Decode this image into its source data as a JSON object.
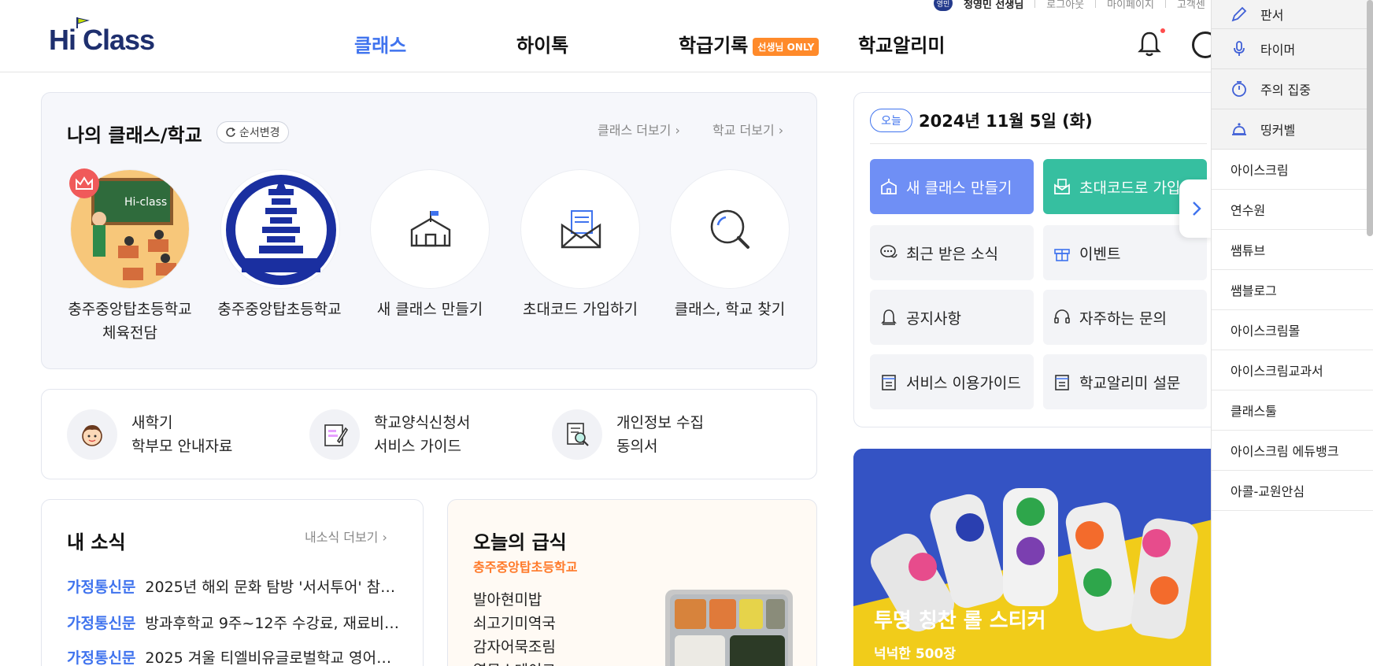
{
  "header": {
    "logo": "Hi Class",
    "nav": [
      {
        "label": "클래스"
      },
      {
        "label": "하이톡"
      },
      {
        "label": "학급기록"
      },
      {
        "label": "학교알리미"
      }
    ],
    "only_badge": "선생님 ONLY",
    "accent": "#3f73ee"
  },
  "util": {
    "badge": "영민",
    "user": "정영민 선생님",
    "logout": "로그아웃",
    "mypage": "마이페이지",
    "support": "고객센"
  },
  "my_class": {
    "title": "나의 클래스/학교",
    "reorder": "순서변경",
    "more_class": "클래스 더보기",
    "more_school": "학교 더보기",
    "items": [
      {
        "label": "충주중앙탑초등학교 체육전담"
      },
      {
        "label": "충주중앙탑초등학교"
      },
      {
        "label": "새 클래스 만들기"
      },
      {
        "label": "초대코드 가입하기"
      },
      {
        "label": "클래스, 학교 찾기"
      }
    ]
  },
  "guides": [
    {
      "line1": "새학기",
      "line2": "학부모 안내자료"
    },
    {
      "line1": "학교양식신청서",
      "line2": "서비스 가이드"
    },
    {
      "line1": "개인정보 수집",
      "line2": "동의서"
    }
  ],
  "news": {
    "title": "내 소식",
    "more": "내소식 더보기",
    "rows": [
      {
        "tag": "가정통신문",
        "text": "2025년 해외 문화 탐방 '서서투어' 참…"
      },
      {
        "tag": "가정통신문",
        "text": "방과후학교 9주~12주 수강료, 재료비…"
      },
      {
        "tag": "가정통신문",
        "text": "2025 겨울 티엘비유글로벌학교 영어…"
      }
    ]
  },
  "meal": {
    "title": "오늘의 급식",
    "school": "충주중앙탑초등학교",
    "items": [
      "발아현미밥",
      "쇠고기미역국",
      "감자어묵조림",
      "열무소테이크"
    ]
  },
  "today": {
    "pill": "오늘",
    "date": "2024년 11월 5일 (화)",
    "buttons": [
      {
        "label": "새 클래스 만들기",
        "icon": "school-icon"
      },
      {
        "label": "초대코드로 가입",
        "icon": "mail-icon"
      },
      {
        "label": "최근 받은 소식",
        "icon": "chat-icon"
      },
      {
        "label": "이벤트",
        "icon": "gift-icon"
      },
      {
        "label": "공지사항",
        "icon": "bell-icon"
      },
      {
        "label": "자주하는 문의",
        "icon": "headset-icon"
      },
      {
        "label": "서비스 이용가이드",
        "icon": "doc-icon"
      },
      {
        "label": "학교알리미 설문",
        "icon": "doc-icon"
      }
    ]
  },
  "banner": {
    "title": "투명 칭찬 롤 스티커",
    "sub": "넉넉한 500장"
  },
  "side_menu": {
    "tools": [
      {
        "label": "판서",
        "icon": "pen-icon"
      },
      {
        "label": "타이머",
        "icon": "mic-icon"
      },
      {
        "label": "주의 집중",
        "icon": "stopwatch-icon"
      },
      {
        "label": "띵커벨",
        "icon": "bell-icon"
      }
    ],
    "links": [
      "아이스크림",
      "연수원",
      "쌤튜브",
      "쌤블로그",
      "아이스크림몰",
      "아이스크림교과서",
      "클래스툴",
      "아이스크림 에듀뱅크",
      "아콜-교원안심"
    ]
  }
}
